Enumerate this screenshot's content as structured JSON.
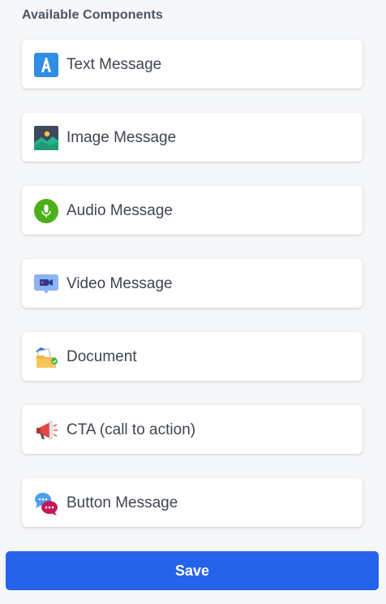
{
  "panel": {
    "title": "Available Components"
  },
  "components": [
    {
      "label": "Text Message",
      "icon": "text-a-icon"
    },
    {
      "label": "Image Message",
      "icon": "image-icon"
    },
    {
      "label": "Audio Message",
      "icon": "microphone-icon"
    },
    {
      "label": "Video Message",
      "icon": "video-camera-icon"
    },
    {
      "label": "Document",
      "icon": "document-folder-icon"
    },
    {
      "label": "CTA (call to action)",
      "icon": "megaphone-icon"
    },
    {
      "label": "Button Message",
      "icon": "chat-bubbles-icon"
    }
  ],
  "actions": {
    "save_label": "Save"
  },
  "colors": {
    "background": "#f6f7f9",
    "card": "#ffffff",
    "accent": "#2563eb",
    "title_text": "#4a5463",
    "label_text": "#3f4550"
  }
}
